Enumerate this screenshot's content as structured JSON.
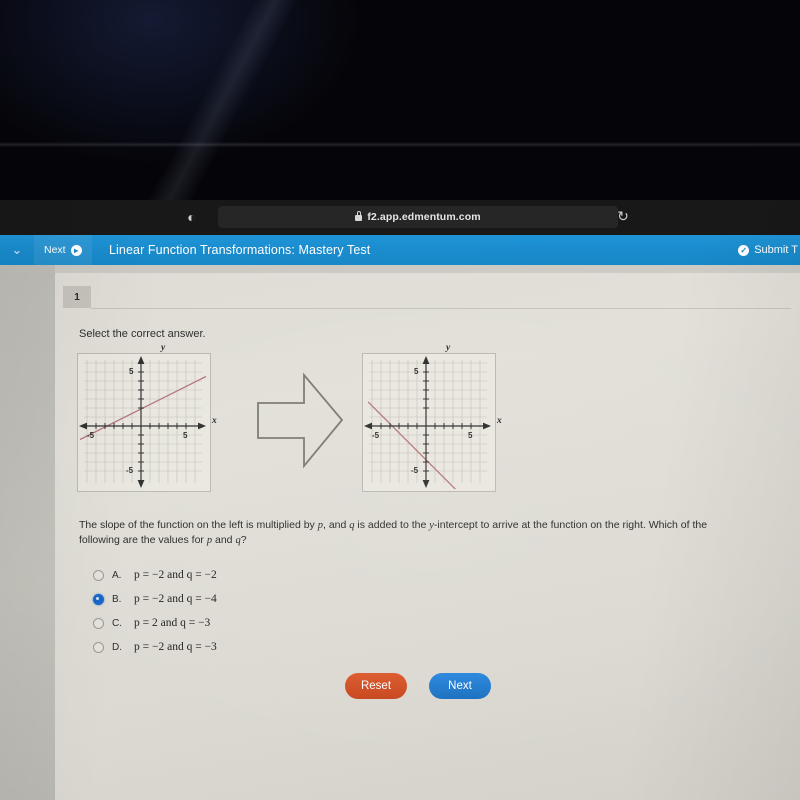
{
  "browser": {
    "url": "f2.app.edmentum.com",
    "lock_icon": "lock-icon",
    "reader_icon": "reader-view-icon",
    "reload_icon": "reload-icon",
    "reload_glyph": "↻",
    "reader_glyph": "◐"
  },
  "header": {
    "chevron_glyph": "⌄",
    "next_label": "Next",
    "next_icon_glyph": "▸",
    "title": "Linear Function Transformations: Mastery Test",
    "submit_label": "Submit T",
    "submit_icon_glyph": "✓",
    "accent_color": "#1a8ccd"
  },
  "question": {
    "number": "1",
    "prompt": "Select the correct answer.",
    "body_part1": "The slope of the function on the left is multiplied by ",
    "body_p": "p",
    "body_part2": ", and ",
    "body_q": "q",
    "body_part3": " is added to the ",
    "body_y": "y",
    "body_part4": "-intercept to arrive at the function on the right. Which of the following are the values for ",
    "body_p2": "p",
    "body_part5": " and ",
    "body_q2": "q",
    "body_part6": "?"
  },
  "options": [
    {
      "letter": "A.",
      "text": "p = −2 and q = −2",
      "selected": false
    },
    {
      "letter": "B.",
      "text": "p = −2 and q = −4",
      "selected": true
    },
    {
      "letter": "C.",
      "text": "p = 2 and q = −3",
      "selected": false
    },
    {
      "letter": "D.",
      "text": "p = −2 and q = −3",
      "selected": false
    }
  ],
  "buttons": {
    "reset_label": "Reset",
    "reset_color": "#c8451d",
    "next_label": "Next",
    "next_color": "#1a6fc0"
  },
  "chart_data": [
    {
      "type": "line",
      "name": "left-graph",
      "title": "",
      "xlabel": "x",
      "ylabel": "y",
      "xlim": [
        -7,
        7
      ],
      "ylim": [
        -7,
        7
      ],
      "xticks": [
        -5,
        5
      ],
      "yticks": [
        5,
        -5
      ],
      "xtick_labels": [
        "-5",
        "5"
      ],
      "ytick_labels": [
        "5",
        "-5"
      ],
      "grid": true,
      "series": [
        {
          "name": "original-function",
          "color": "#b07a80",
          "slope": 0.5,
          "intercept": 1,
          "x_intercept": -2,
          "points": [
            [
              -7,
              -2.5
            ],
            [
              7,
              4.5
            ]
          ]
        }
      ]
    },
    {
      "type": "line",
      "name": "right-graph",
      "title": "",
      "xlabel": "x",
      "ylabel": "y",
      "xlim": [
        -7,
        7
      ],
      "ylim": [
        -7,
        7
      ],
      "xticks": [
        -5,
        5
      ],
      "yticks": [
        5,
        -5
      ],
      "xtick_labels": [
        "-5",
        "5"
      ],
      "ytick_labels": [
        "5",
        "-5"
      ],
      "grid": true,
      "series": [
        {
          "name": "transformed-function",
          "color": "#b07a80",
          "slope": -1,
          "intercept": -3,
          "x_intercept": -3,
          "points": [
            [
              -7,
              4
            ],
            [
              7,
              -10
            ]
          ]
        }
      ]
    }
  ],
  "figure": {
    "arrow_icon": "right-arrow-icon",
    "left_axis_x": "x",
    "left_axis_y": "y",
    "left_tick_neg5": "-5",
    "left_tick_pos5": "5",
    "left_tick_y5": "5",
    "left_tick_yneg5": "-5",
    "right_axis_x": "x",
    "right_axis_y": "y",
    "right_tick_neg5": "-5",
    "right_tick_pos5": "5",
    "right_tick_y5": "5",
    "right_tick_yneg5": "-5"
  }
}
